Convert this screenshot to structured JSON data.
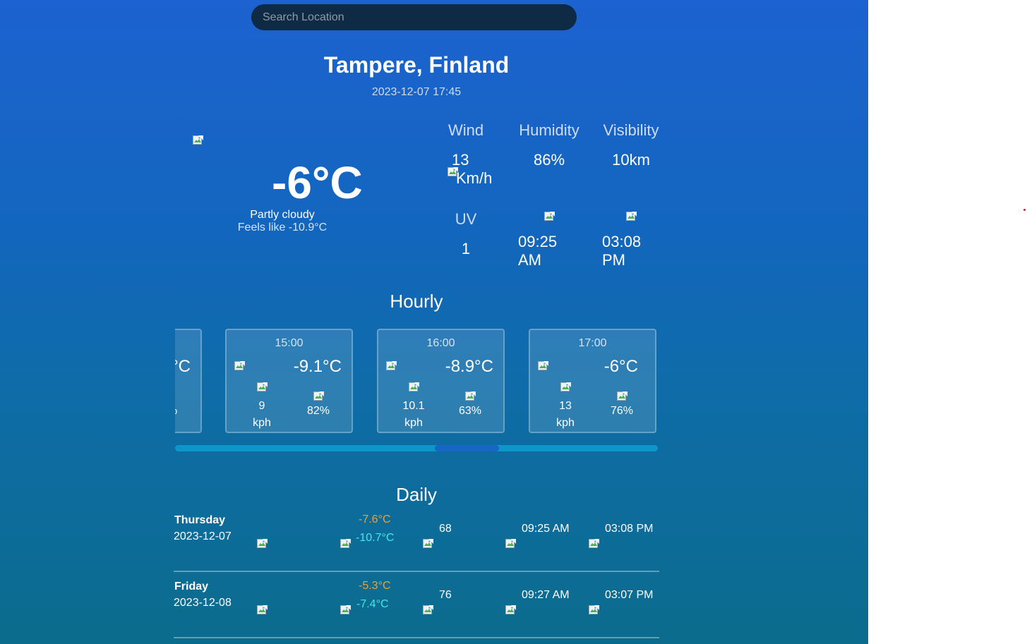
{
  "search": {
    "placeholder": "Search Location"
  },
  "location": {
    "city": "Tampere, Finland",
    "datetime": "2023-12-07 17:45"
  },
  "current": {
    "temperature": "-6°C",
    "condition": "Partly cloudy",
    "feels_like": "Feels like -10.9°C"
  },
  "stats": {
    "wind_label": "Wind",
    "wind_value": "13",
    "wind_unit": "Km/h",
    "humidity_label": "Humidity",
    "humidity_value": "86%",
    "visibility_label": "Visibility",
    "visibility_value": "10km",
    "uv_label": "UV",
    "uv_value": "1",
    "sunrise_time": "09:25",
    "sunrise_ampm": "AM",
    "sunset_time": "03:08",
    "sunset_ampm": "PM"
  },
  "hourly": {
    "title": "Hourly",
    "partial_card": {
      "temp_fragment": "°C",
      "hum_fragment": "%"
    },
    "cards": [
      {
        "time": "15:00",
        "temp": "-9.1°C",
        "wind": "9",
        "wind_unit": "kph",
        "humidity": "82%"
      },
      {
        "time": "16:00",
        "temp": "-8.9°C",
        "wind": "10.1",
        "wind_unit": "kph",
        "humidity": "63%"
      },
      {
        "time": "17:00",
        "temp": "-6°C",
        "wind": "13",
        "wind_unit": "kph",
        "humidity": "76%"
      }
    ],
    "scroll_position": 0.62
  },
  "daily": {
    "title": "Daily",
    "rows": [
      {
        "day": "Thursday",
        "date": "2023-12-07",
        "max": "-7.6°C",
        "min": "-10.7°C",
        "value": "68",
        "sunrise": "09:25 AM",
        "sunset": "03:08 PM"
      },
      {
        "day": "Friday",
        "date": "2023-12-08",
        "max": "-5.3°C",
        "min": "-7.4°C",
        "value": "76",
        "sunrise": "09:27 AM",
        "sunset": "03:07 PM"
      }
    ]
  },
  "colors": {
    "bg_top": "#1c62d0",
    "bg_bottom": "#0b6c8d",
    "search_bg": "#0e2a44",
    "max_temp": "#f0a030",
    "min_temp": "#40e8e8",
    "scroll_track": "#0f96c8",
    "scroll_thumb": "#1666c4"
  }
}
